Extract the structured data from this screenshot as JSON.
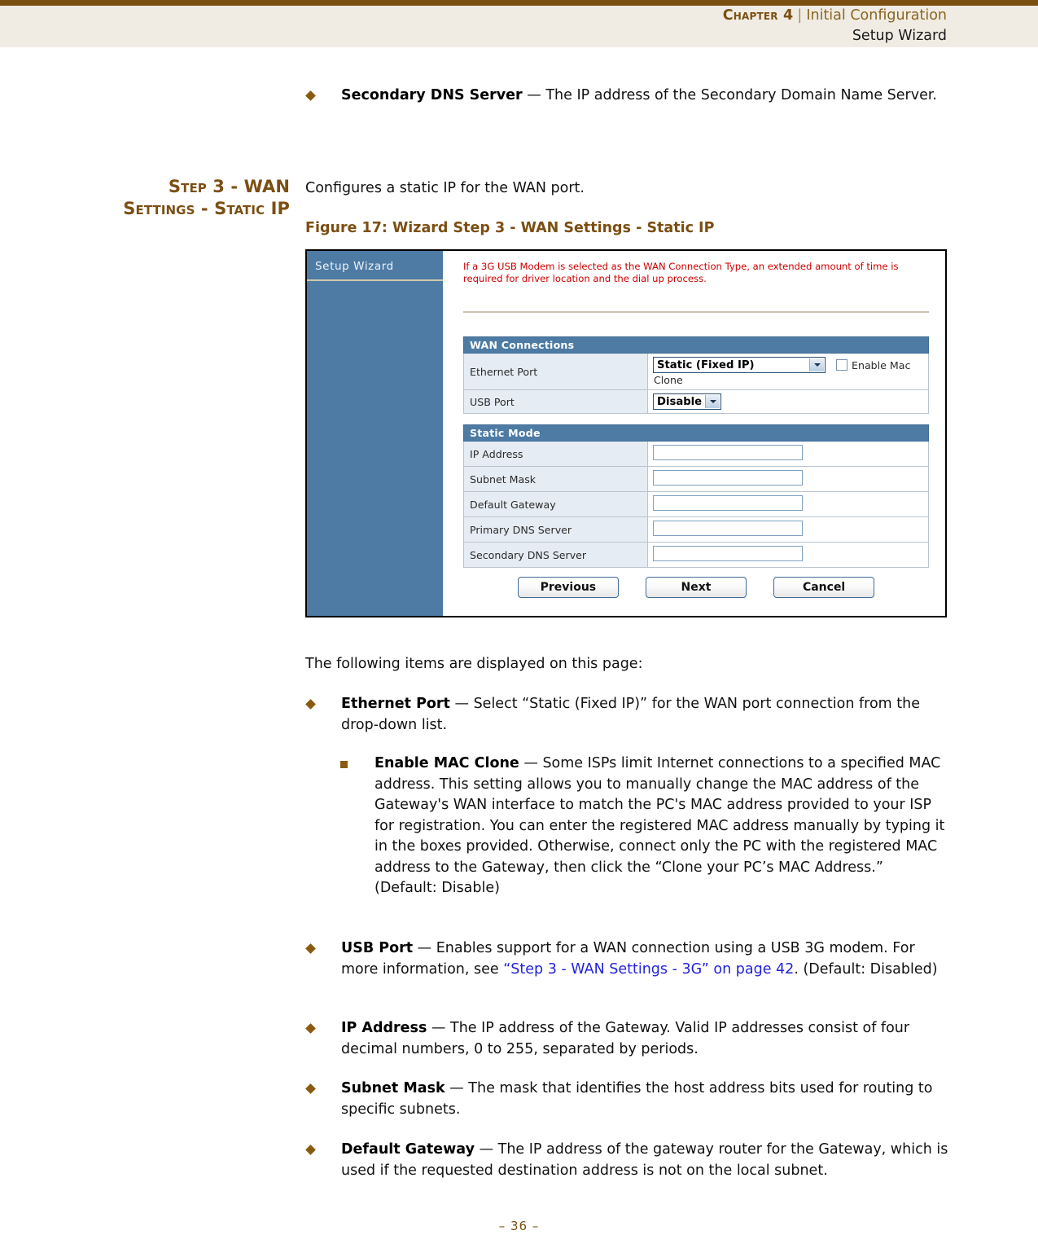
{
  "header": {
    "chapter": "Chapter 4",
    "separator": "|",
    "topic": "Initial Configuration",
    "subtopic": "Setup Wizard"
  },
  "margin_heading": {
    "line1": "Step 3 - WAN",
    "line2": "Settings - Static IP"
  },
  "intro_bullet": {
    "term": "Secondary DNS Server",
    "dash": " — ",
    "text": "The IP address of the Secondary Domain Name Server."
  },
  "section_intro": "Configures a static IP for the WAN port.",
  "figure_caption": "Figure 17:  Wizard Step 3 - WAN Settings - Static IP",
  "figure": {
    "sidebar_title": "Setup Wizard",
    "warning": "If a 3G USB Modem is selected as the WAN Connection Type, an extended amount of time is required for driver location and the dial up process.",
    "wan_section_title": "WAN Connections",
    "static_section_title": "Static Mode",
    "wan_rows": [
      {
        "label": "Ethernet Port",
        "control": "select",
        "value": "Static (Fixed IP)",
        "checkbox_label": "Enable Mac",
        "checkbox_label_wrap": "Clone",
        "checkbox_checked": false
      },
      {
        "label": "USB Port",
        "control": "select",
        "value": "Disable"
      }
    ],
    "static_rows": [
      {
        "label": "IP Address",
        "value": ""
      },
      {
        "label": "Subnet Mask",
        "value": ""
      },
      {
        "label": "Default Gateway",
        "value": ""
      },
      {
        "label": "Primary DNS Server",
        "value": ""
      },
      {
        "label": "Secondary DNS Server",
        "value": ""
      }
    ],
    "buttons": [
      {
        "label": "Previous"
      },
      {
        "label": "Next"
      },
      {
        "label": "Cancel"
      }
    ],
    "colors": {
      "sidebar": "#4d7ba4",
      "section_header": "#4d7ba4",
      "label_cell": "#e6ecf3",
      "warning_text": "#cc0000"
    }
  },
  "body_intro": "The following items are displayed on this page:",
  "bullets": [
    {
      "term": "Ethernet Port",
      "dash": " — ",
      "text": "Select “Static (Fixed IP)” for the WAN port connection from the drop-down list."
    },
    {
      "term": "USB Port",
      "dash": " — ",
      "text_before": "Enables support for a WAN connection using a USB 3G modem. For more information, see ",
      "link": "“Step 3 - WAN Settings - 3G” on page 42",
      "text_after": ". (Default: Disabled)"
    },
    {
      "term": "IP Address",
      "dash": " — ",
      "text": "The IP address of the Gateway. Valid IP addresses consist of four decimal numbers, 0 to 255, separated by periods."
    },
    {
      "term": "Subnet Mask",
      "dash": " — ",
      "text": "The mask that identifies the host address bits used for routing to specific subnets."
    },
    {
      "term": "Default Gateway",
      "dash": " — ",
      "text": "The IP address of the gateway router for the Gateway, which is used if the requested destination address is not on the local subnet."
    }
  ],
  "subbullet": {
    "term": "Enable MAC Clone",
    "dash": " — ",
    "text": "Some ISPs limit Internet connections to a specified MAC address. This setting allows you to manually change the MAC address of the Gateway's WAN interface to match the PC's MAC address provided to your ISP for registration. You can enter the registered MAC address manually by typing it in the boxes provided. Otherwise, connect only the PC with the registered MAC address to the Gateway, then click the “Clone your PC’s MAC Address.” (Default: Disable)"
  },
  "footer": {
    "page": "–  36  –"
  },
  "theme": {
    "brand_brown": "#7b4f12",
    "bullet_brown": "#8a5a10",
    "link_blue": "#2222dd",
    "header_band": "#f0ece3"
  }
}
